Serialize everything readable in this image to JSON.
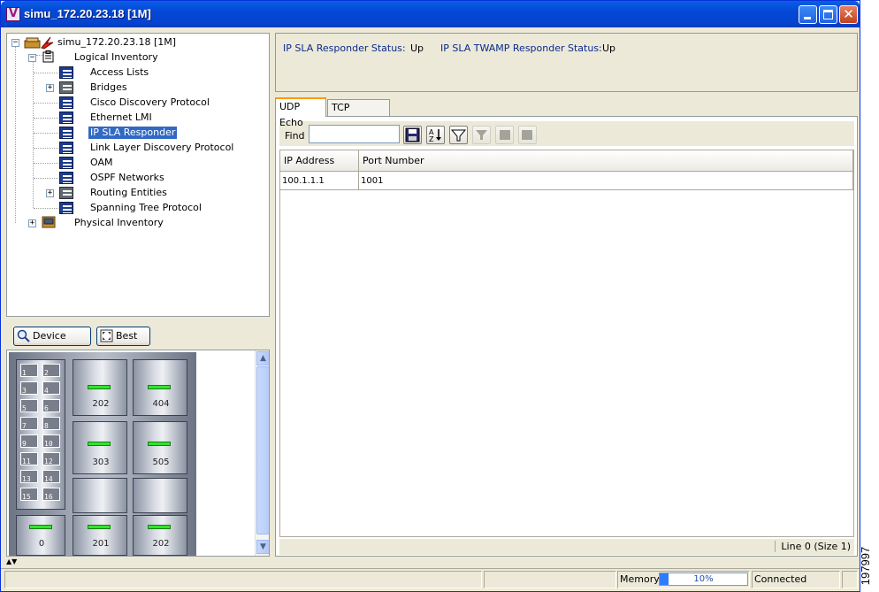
{
  "window": {
    "title": "simu_172.20.23.18 [1M]"
  },
  "tree": {
    "root": "simu_172.20.23.18 [1M]",
    "logical": "Logical Inventory",
    "items": [
      {
        "label": "Access Lists"
      },
      {
        "label": "Bridges"
      },
      {
        "label": "Cisco Discovery Protocol"
      },
      {
        "label": "Ethernet LMI"
      },
      {
        "label": "IP SLA Responder"
      },
      {
        "label": "Link Layer Discovery Protocol"
      },
      {
        "label": "OAM"
      },
      {
        "label": "OSPF Networks"
      },
      {
        "label": "Routing Entities"
      },
      {
        "label": "Spanning Tree Protocol"
      }
    ],
    "physical": "Physical Inventory",
    "selected": "IP SLA Responder"
  },
  "zoom": {
    "device_zoom": "Device Zoom",
    "best_fit": "Best Fit"
  },
  "chassis": {
    "ports": [
      "1",
      "2",
      "3",
      "4",
      "5",
      "6",
      "7",
      "8",
      "9",
      "10",
      "11",
      "12",
      "13",
      "14",
      "15",
      "16"
    ],
    "slots_top": [
      "202",
      "404"
    ],
    "slots_mid": [
      "303",
      "505"
    ],
    "slots_bottom": [
      "0",
      "201",
      "202"
    ]
  },
  "status": {
    "responder_label": "IP SLA Responder Status:",
    "responder_value": "Up",
    "twamp_label": "IP SLA TWAMP Responder Status:",
    "twamp_value": "Up"
  },
  "tabs": [
    {
      "label": "UDP Echo"
    },
    {
      "label": "TCP Connect"
    }
  ],
  "table": {
    "find_label": "Find :",
    "find_value": "",
    "columns": [
      "IP Address",
      "Port Number"
    ],
    "rows": [
      {
        "ip": "100.1.1.1",
        "port": "1001"
      }
    ],
    "footer": "Line 0 (Size 1)"
  },
  "statusbar": {
    "memory_label": "Memory:",
    "memory_percent": "10%",
    "memory_fraction": 0.1,
    "connection": "Connected"
  },
  "side_number": "197997"
}
